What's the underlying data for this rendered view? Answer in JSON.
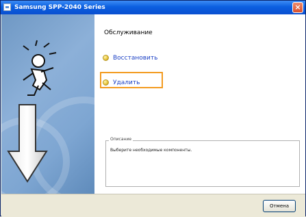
{
  "window": {
    "title": "Samsung SPP-2040 Series"
  },
  "main": {
    "heading": "Обслуживание",
    "options": [
      {
        "label": "Восстановить"
      },
      {
        "label": "Удалить"
      }
    ]
  },
  "description": {
    "label": "Описание",
    "text": "Выберите необходимые компоненты."
  },
  "footer": {
    "cancel_label": "Отмена"
  }
}
